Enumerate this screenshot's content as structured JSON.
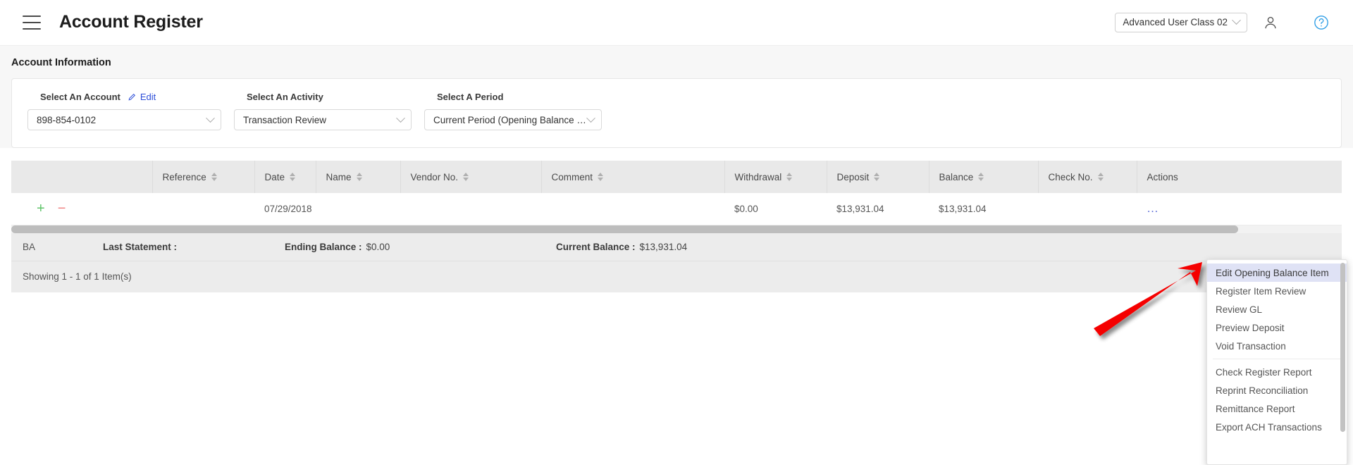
{
  "header": {
    "menu_icon": "hamburger-icon",
    "title": "Account Register",
    "user_class": "Advanced User Class 02",
    "avatar_icon": "user-avatar-icon",
    "help_icon": "help-circle-icon"
  },
  "account_information": {
    "section_title": "Account Information",
    "account": {
      "label": "Select An Account",
      "edit_label": "Edit",
      "edit_icon": "pencil-icon",
      "value": "898-854-0102"
    },
    "activity": {
      "label": "Select An Activity",
      "value": "Transaction Review"
    },
    "period": {
      "label": "Select A Period",
      "value": "Current Period (Opening Balance M..."
    }
  },
  "table": {
    "columns": [
      {
        "label": "",
        "sortable": false
      },
      {
        "label": "Reference",
        "sortable": true
      },
      {
        "label": "Date",
        "sortable": true
      },
      {
        "label": "Name",
        "sortable": true
      },
      {
        "label": "Vendor No.",
        "sortable": true
      },
      {
        "label": "Comment",
        "sortable": true
      },
      {
        "label": "Withdrawal",
        "sortable": true
      },
      {
        "label": "Deposit",
        "sortable": true
      },
      {
        "label": "Balance",
        "sortable": true
      },
      {
        "label": "Check No.",
        "sortable": true
      },
      {
        "label": "Actions",
        "sortable": false
      }
    ],
    "rows": [
      {
        "add_icon": "plus-icon",
        "remove_icon": "minus-icon",
        "reference": "",
        "date": "07/29/2018",
        "name": "",
        "vendor_no": "",
        "comment": "",
        "withdrawal": "$0.00",
        "deposit": "$13,931.04",
        "balance": "$13,931.04",
        "check_no": "",
        "actions_icon": "ellipsis-icon"
      }
    ]
  },
  "summary": {
    "code": "BA",
    "last_statement_label": "Last Statement :",
    "last_statement_value": "",
    "ending_balance_label": "Ending Balance :",
    "ending_balance_value": "$0.00",
    "current_balance_label": "Current Balance :",
    "current_balance_value": "$13,931.04"
  },
  "footer": {
    "showing_text": "Showing 1 - 1 of 1 Item(s)",
    "prev_icon": "chevron-left-icon"
  },
  "context_menu": {
    "items": [
      {
        "label": "Edit Opening Balance Item",
        "selected": true
      },
      {
        "label": "Register Item Review",
        "selected": false
      },
      {
        "label": "Review GL",
        "selected": false
      },
      {
        "label": "Preview Deposit",
        "selected": false
      },
      {
        "label": "Void Transaction",
        "selected": false
      },
      {
        "label": "Check Register Report",
        "selected": false,
        "separator_before": true
      },
      {
        "label": "Reprint Reconciliation",
        "selected": false
      },
      {
        "label": "Remittance Report",
        "selected": false
      },
      {
        "label": "Export ACH Transactions",
        "selected": false
      }
    ]
  },
  "colors": {
    "accent_blue": "#2b4cd8",
    "help_blue": "#2f9ee6",
    "menu_highlight": "#dfe2f5",
    "annotation_red": "#f50000",
    "add_green": "#5fc46a",
    "remove_red": "#ef8080"
  }
}
